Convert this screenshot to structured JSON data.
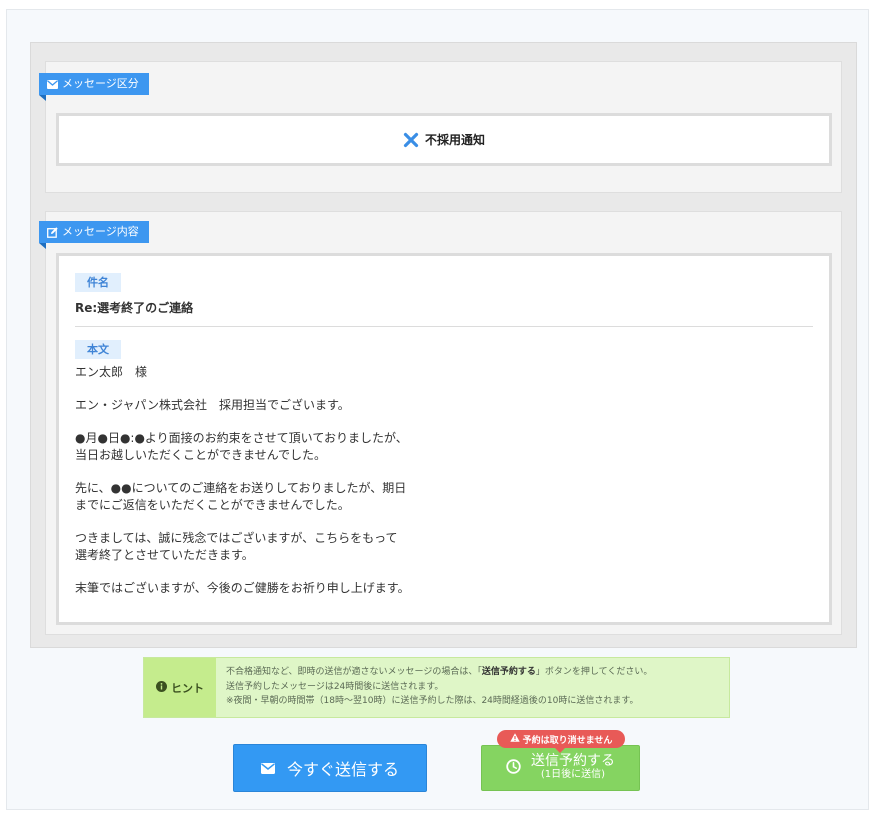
{
  "section_kind": {
    "header": "メッセージ区分",
    "selected_label": "不採用通知"
  },
  "section_content": {
    "header": "メッセージ内容",
    "subject_label": "件名",
    "subject_value": "Re:選考終了のご連絡",
    "body_label": "本文",
    "body_paragraphs": [
      [
        "エン太郎　様"
      ],
      [
        "エン・ジャパン株式会社　採用担当でございます。"
      ],
      [
        "●月●日●:●より面接のお約束をさせて頂いておりましたが、",
        "当日お越しいただくことができませんでした。"
      ],
      [
        "先に、●●についてのご連絡をお送りしておりましたが、期日",
        "までにご返信をいただくことができませんでした。"
      ],
      [
        "つきましては、誠に残念ではございますが、こちらをもって",
        "選考終了とさせていただきます。"
      ],
      [
        "末筆ではございますが、今後のご健勝をお祈り申し上げます。"
      ]
    ]
  },
  "hint": {
    "label": "ヒント",
    "line1_prefix": "不合格通知など、即時の送信が適さないメッセージの場合は、「",
    "line1_bold": "送信予約する",
    "line1_suffix": "」ボタンを押してください。",
    "line2": "送信予約したメッセージは24時間後に送信されます。",
    "line3": "※夜間・早朝の時間帯（18時～翌10時）に送信予約した際は、24時間経過後の10時に送信されます。"
  },
  "actions": {
    "send_now_label": "今すぐ送信する",
    "schedule_label": "送信予約する",
    "schedule_sub": "(1日後に送信)",
    "warning": "予約は取り消せません"
  },
  "colors": {
    "primary_blue": "#3399f3",
    "schedule_green": "#85d461",
    "warning_red": "#e85a57",
    "x_mark_blue": "#3a8ee6"
  },
  "icons": {
    "kind_header": "envelope-icon",
    "content_header": "edit-icon",
    "selected_kind": "x-mark-icon",
    "hint": "info-icon",
    "send_now": "envelope-icon",
    "schedule": "clock-icon",
    "warning": "warning-triangle-icon"
  }
}
